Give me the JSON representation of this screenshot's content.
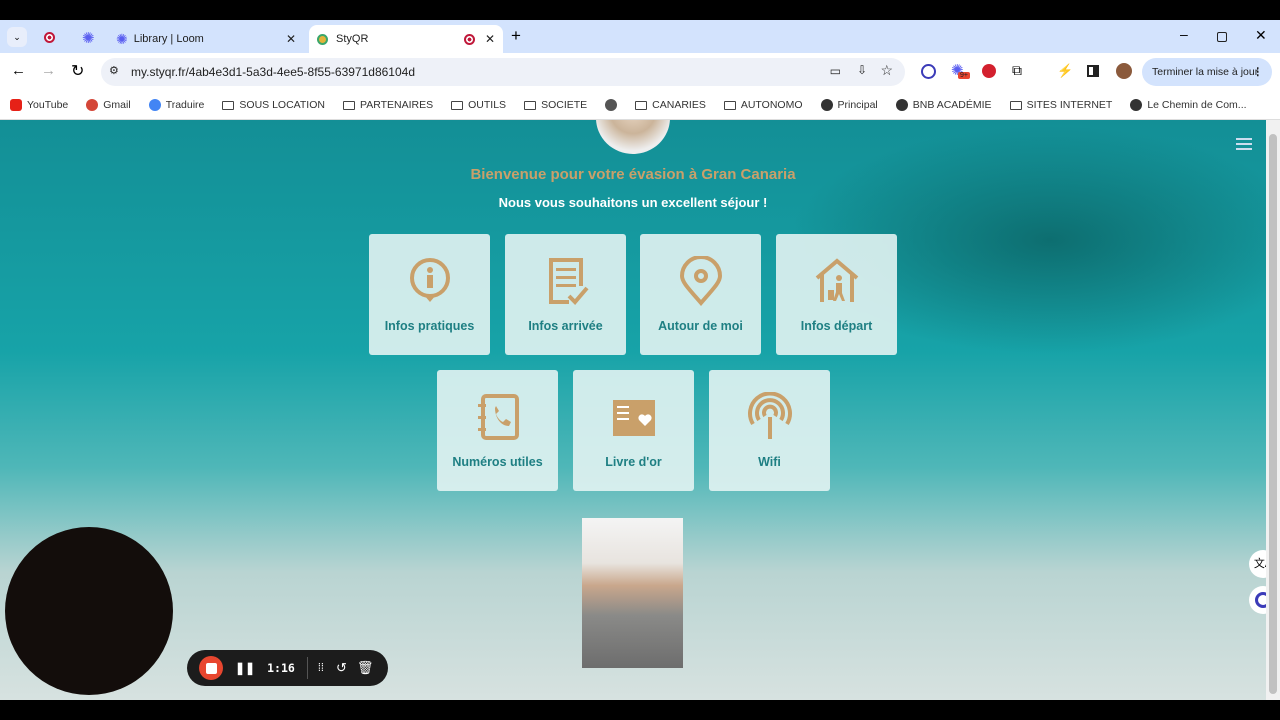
{
  "browser": {
    "tabs": [
      {
        "label": "Library | Loom"
      },
      {
        "label": "StyQR"
      }
    ],
    "url": "my.styqr.fr/4ab4e3d1-5a3d-4ee5-8f55-63971d86104d",
    "update_button": "Terminer la mise à jour",
    "extension_badge": "9+",
    "bookmarks": [
      {
        "label": "YouTube",
        "icon": "youtube-icon"
      },
      {
        "label": "Gmail",
        "icon": "gmail-icon"
      },
      {
        "label": "Traduire",
        "icon": "translate-icon"
      },
      {
        "label": "SOUS LOCATION",
        "icon": "folder-icon"
      },
      {
        "label": "PARTENAIRES",
        "icon": "folder-icon"
      },
      {
        "label": "OUTILS",
        "icon": "folder-icon"
      },
      {
        "label": "SOCIETE",
        "icon": "folder-icon"
      },
      {
        "label": "",
        "icon": "globe-icon"
      },
      {
        "label": "CANARIES",
        "icon": "folder-icon"
      },
      {
        "label": "AUTONOMO",
        "icon": "folder-icon"
      },
      {
        "label": "Principal",
        "icon": "site-icon"
      },
      {
        "label": "BNB ACADÉMIE",
        "icon": "site-icon"
      },
      {
        "label": "SITES INTERNET",
        "icon": "folder-icon"
      },
      {
        "label": "Le Chemin de Com...",
        "icon": "site-icon"
      }
    ]
  },
  "page": {
    "title": "Bienvenue pour votre évasion à Gran Canaria",
    "subtitle": "Nous vous souhaitons un excellent séjour !",
    "accent": "#c9a06a",
    "tiles": [
      {
        "label": "Infos pratiques",
        "icon": "info-pin-icon"
      },
      {
        "label": "Infos arrivée",
        "icon": "checklist-icon"
      },
      {
        "label": "Autour de moi",
        "icon": "location-pin-icon"
      },
      {
        "label": "Infos départ",
        "icon": "house-traveler-icon"
      },
      {
        "label": "Numéros utiles",
        "icon": "phonebook-icon"
      },
      {
        "label": "Livre d'or",
        "icon": "guestbook-icon"
      },
      {
        "label": "Wifi",
        "icon": "wifi-icon"
      }
    ]
  },
  "recorder": {
    "time": "1:16"
  }
}
